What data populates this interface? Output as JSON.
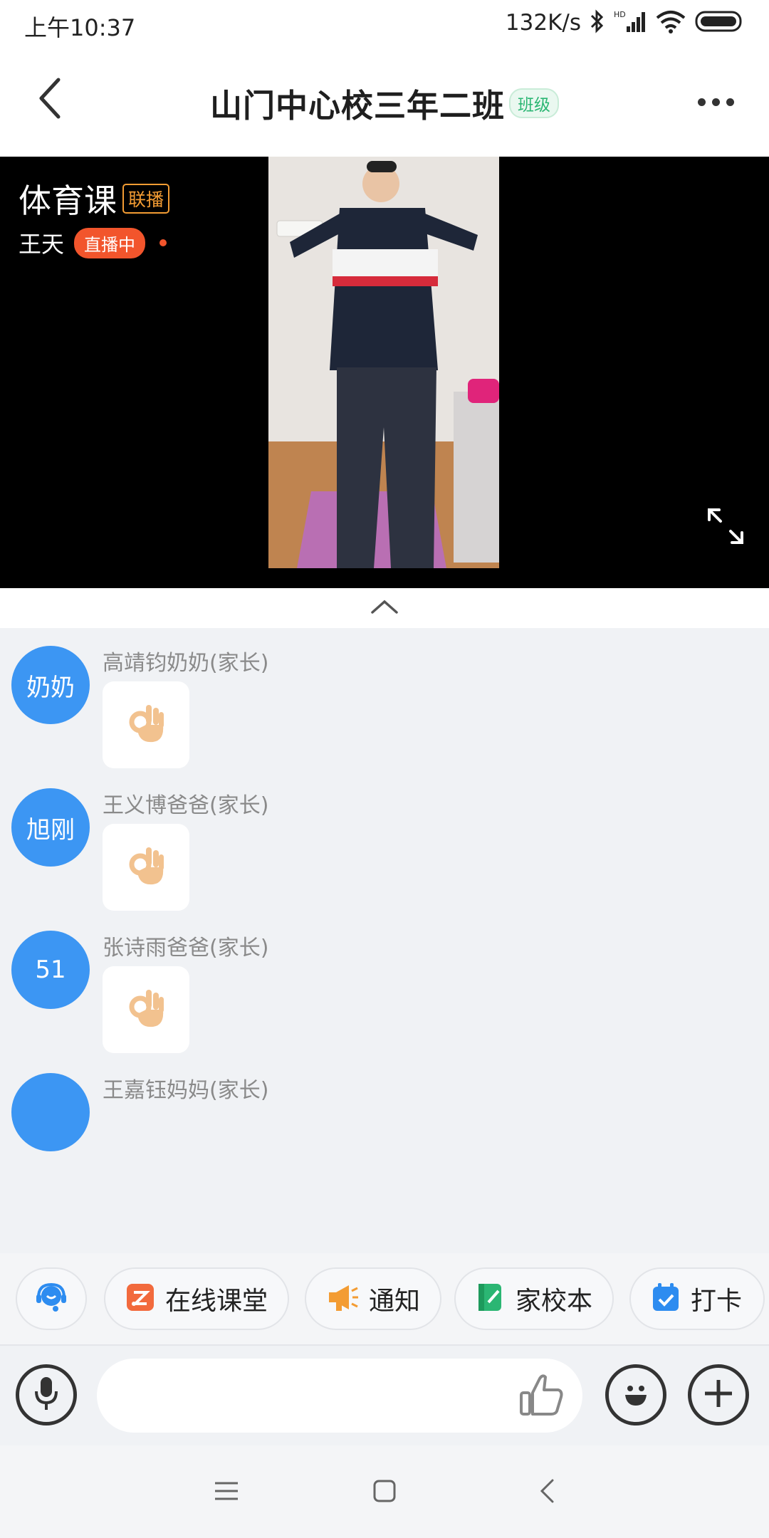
{
  "status_bar": {
    "time": "上午10:37",
    "network_speed": "132K/s",
    "icons": [
      "bluetooth-icon",
      "hd-signal-icon",
      "wifi-icon",
      "battery-icon"
    ]
  },
  "header": {
    "title": "山门中心校三年二班",
    "tag": "班级",
    "icons": [
      "back-arrow-icon",
      "more-dots-icon"
    ]
  },
  "video": {
    "course_title": "体育课",
    "relay_tag": "联播",
    "host_name": "王天",
    "live_badge": "直播中",
    "icons": [
      "expand-icon"
    ]
  },
  "messages": [
    {
      "avatar_text": "奶奶",
      "sender": "高靖钧奶奶(家长)",
      "content_icon": "ok-hand-emoji"
    },
    {
      "avatar_text": "旭刚",
      "sender": "王义博爸爸(家长)",
      "content_icon": "ok-hand-emoji"
    },
    {
      "avatar_text": "51",
      "sender": "张诗雨爸爸(家长)",
      "content_icon": "ok-hand-emoji"
    },
    {
      "avatar_text": "",
      "sender": "王嘉钰妈妈(家长)",
      "content_icon": ""
    }
  ],
  "quick_actions": [
    {
      "label": "",
      "icon": "assistant-icon"
    },
    {
      "label": "在线课堂",
      "icon": "online-class-icon",
      "color": "#f26a3d"
    },
    {
      "label": "通知",
      "icon": "megaphone-icon",
      "color": "#f39c33"
    },
    {
      "label": "家校本",
      "icon": "notebook-icon",
      "color": "#2bb673"
    },
    {
      "label": "打卡",
      "icon": "calendar-check-icon",
      "color": "#2d8cf0"
    }
  ],
  "input_bar": {
    "placeholder": "",
    "icons": [
      "microphone-icon",
      "thumbs-up-icon",
      "emoji-icon",
      "plus-icon"
    ]
  },
  "nav_bar": {
    "icons": [
      "menu-icon",
      "home-icon",
      "back-icon"
    ]
  },
  "colors": {
    "avatar_blue": "#3c96f3",
    "live_red": "#f2552c",
    "relay_orange": "#f39c33",
    "class_tag_green": "#2bb673"
  }
}
